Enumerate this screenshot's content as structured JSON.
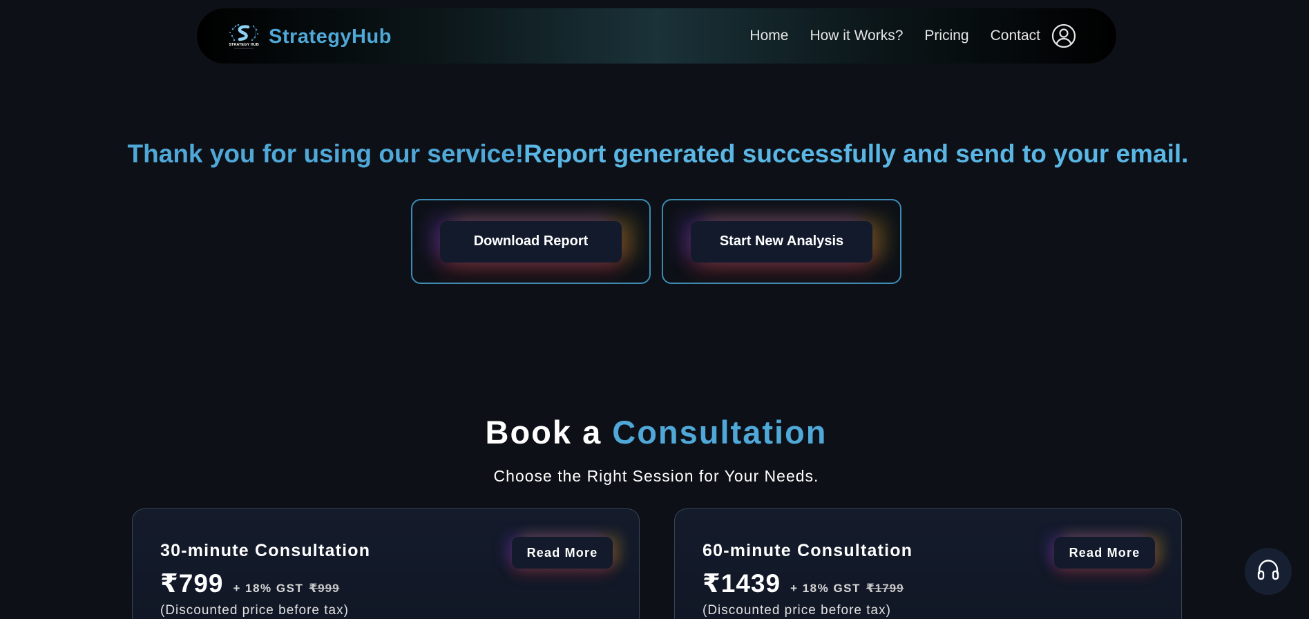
{
  "navbar": {
    "brand_name": "StrategyHub",
    "logo_text": "STRATEGY HUB",
    "links": [
      "Home",
      "How it Works?",
      "Pricing",
      "Contact"
    ],
    "user_icon": "user-circle-icon"
  },
  "hero": {
    "thanks_text": "Thank you for using our service!",
    "report_text": "Report generated successfully and send to your email.",
    "download_button": "Download Report",
    "new_analysis_button": "Start New Analysis"
  },
  "consultation": {
    "title_prefix": "Book a",
    "title_accent": "Consultation",
    "subtitle": "Choose the Right Session for Your Needs.",
    "cards": [
      {
        "title": "30-minute Consultation",
        "price": "₹799",
        "gst": "+ 18% GST",
        "old_price": "₹999",
        "note": "(Discounted price before tax)",
        "button": "Read More"
      },
      {
        "title": "60-minute Consultation",
        "price": "₹1439",
        "gst": "+ 18% GST",
        "old_price": "₹1799",
        "note": "(Discounted price before tax)",
        "button": "Read More"
      }
    ]
  },
  "support": {
    "icon": "headset-icon"
  },
  "colors": {
    "background": "#0d1117",
    "accent": "#4fa8d8",
    "button_bg": "#121a2c",
    "border": "#3c8cb4"
  }
}
